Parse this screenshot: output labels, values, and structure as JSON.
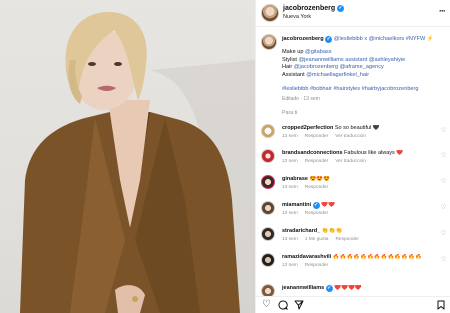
{
  "post": {
    "username": "jacobrozenberg",
    "location": "Nueva York"
  },
  "caption": {
    "username": "jacobrozenberg",
    "mentions_line": "@lesliebibb x @michaelkors #NYFW",
    "lines": [
      {
        "prefix": "Make up ",
        "handle": "@gitabass"
      },
      {
        "prefix": "Stylist ",
        "handle": "@jeanannwilliams assistant @ashleyahiyie"
      },
      {
        "prefix": "Hair ",
        "handle": "@jacobrozenberg @aframe_agency"
      },
      {
        "prefix": "Assistant ",
        "handle": "@michaellagarfinkel_hair"
      }
    ],
    "hashtags": "#lesliebibb #bobhair #hairstyles #hairbyjacobrozenberg",
    "meta": "Editado · 13 sem"
  },
  "para_ti": "Para ti",
  "comments": [
    {
      "user": "cropped2perfection",
      "text": "So so beautiful 🖤",
      "meta": [
        "13 sem",
        "Responder",
        "Ver traducción"
      ]
    },
    {
      "user": "brandsandconnections",
      "text": "Fabulous like always ❤️",
      "meta": [
        "13 sem",
        "Responder",
        "Ver traducción"
      ]
    },
    {
      "user": "ginabrase",
      "text": "😍😍😍",
      "meta": [
        "13 sem",
        "Responder"
      ]
    },
    {
      "user": "miamantini",
      "text": "❤️❤️",
      "meta": [
        "13 sem",
        "Responder"
      ]
    },
    {
      "user": "stradarichard_",
      "text": "👏👏👏",
      "meta": [
        "13 sem",
        "1 Me gusta",
        "Responder"
      ]
    },
    {
      "user": "ramazidavarashvili",
      "text": "🔥🔥🔥🔥🔥🔥🔥🔥🔥🔥🔥🔥🔥",
      "meta": [
        "13 sem",
        "Responder"
      ]
    },
    {
      "user": "jeanannwilliams",
      "text": "❤️❤️❤️❤️",
      "meta": []
    }
  ],
  "icons": {
    "more": "more-icon",
    "like": "heart-icon",
    "comment": "comment-icon",
    "share": "share-icon",
    "save": "bookmark-icon"
  },
  "colors": {
    "link": "#3a5fb0",
    "verified": "#1e90f5",
    "muted": "#8e8e8e"
  }
}
